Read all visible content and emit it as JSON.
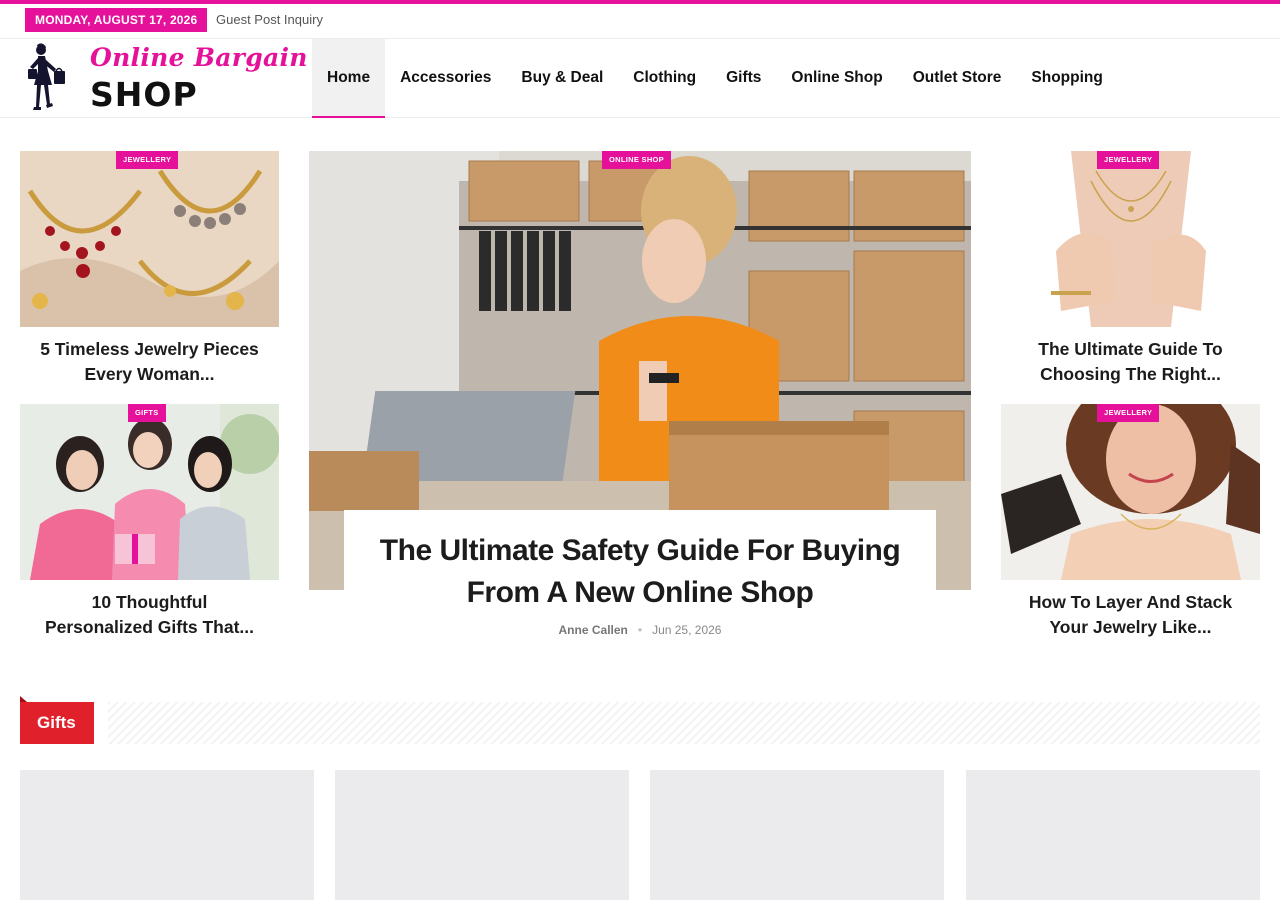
{
  "topbar": {
    "date": "MONDAY, AUGUST 17, 2026",
    "link": "Guest Post Inquiry"
  },
  "logo": {
    "script_text": "Online Bargain",
    "main_text": "SHOP"
  },
  "nav": {
    "items": [
      "Home",
      "Accessories",
      "Buy & Deal",
      "Clothing",
      "Gifts",
      "Online Shop",
      "Outlet Store",
      "Shopping"
    ],
    "active": "Home"
  },
  "cards": {
    "left_top": {
      "category": "JEWELLERY",
      "title_line1": "5 Timeless Jewelry Pieces",
      "title_line2": "Every Woman..."
    },
    "left_bottom": {
      "category": "GIFTS",
      "title_line1": "10 Thoughtful",
      "title_line2": "Personalized Gifts That..."
    },
    "right_top": {
      "category": "JEWELLERY",
      "title_line1": "The Ultimate Guide To",
      "title_line2": "Choosing The Right..."
    },
    "right_bottom": {
      "category": "JEWELLERY",
      "title_line1": "How To Layer And Stack",
      "title_line2": "Your Jewelry Like..."
    }
  },
  "featured": {
    "category": "ONLINE SHOP",
    "title_line1": "The Ultimate Safety Guide For Buying",
    "title_line2": "From A New Online Shop",
    "author": "Anne Callen",
    "date": "Jun 25, 2026"
  },
  "section": {
    "title": "Gifts"
  },
  "colors": {
    "accent": "#e6119a",
    "section_red": "#e0202b",
    "placeholder": "#ebebee"
  }
}
